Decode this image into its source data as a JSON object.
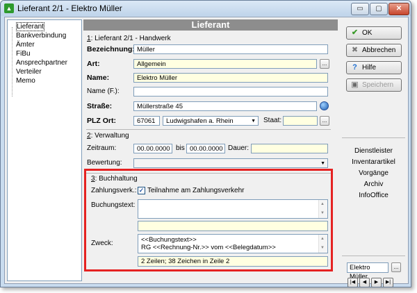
{
  "window": {
    "title": "Lieferant 2/1 - Elektro Müller",
    "minimize": "▭",
    "maximize": "▢",
    "close": "✕"
  },
  "tree": {
    "items": [
      "Lieferant",
      "Bankverbindung",
      "Ämter",
      "FiBu",
      "Ansprechpartner",
      "Verteiler",
      "Memo"
    ]
  },
  "header": {
    "title": "Lieferant"
  },
  "section1": {
    "num": "1",
    "heading": ": Lieferant 2/1 - Handwerk",
    "bezeichnung_label": "Bezeichnung:",
    "bezeichnung": "Müller",
    "art_label": "Art:",
    "art": "Allgemein",
    "name_label": "Name:",
    "name": "Elektro Müller",
    "namef_label": "Name (F.):",
    "namef": "",
    "strasse_label": "Straße:",
    "strasse": "Müllerstraße 45",
    "plz_label": "PLZ Ort:",
    "plz": "67061",
    "ort": "Ludwigshafen a. Rhein",
    "staat_label": "Staat:",
    "staat": ""
  },
  "section2": {
    "num": "2",
    "heading": ": Verwaltung",
    "zeitraum_label": "Zeitraum:",
    "von": "00.00.0000",
    "bis_label": "bis",
    "bis": "00.00.0000",
    "dauer_label": "Dauer:",
    "dauer": "",
    "bewertung_label": "Bewertung:",
    "bewertung": ""
  },
  "section3": {
    "num": "3",
    "heading": ": Buchhaltung",
    "zahlungsverk_label": "Zahlungsverk.:",
    "checkbox_label": "Teilnahme am Zahlungsverkehr",
    "checked": true,
    "buchungstext_label": "Buchungstext:",
    "buchungstext": "",
    "extra": "",
    "zweck_label": "Zweck:",
    "zweck_line1": "<<Buchungstext>>",
    "zweck_line2": "RG <<Rechnung-Nr.>> vom <<Belegdatum>>",
    "status": "2 Zeilen; 38 Zeichen in Zeile 2"
  },
  "buttons": {
    "ok": "OK",
    "abbrechen": "Abbrechen",
    "hilfe": "Hilfe",
    "speichern": "Speichern"
  },
  "links": [
    "Dienstleister",
    "Inventarartikel",
    "Vorgänge",
    "Archiv",
    "InfoOffice"
  ],
  "nav": {
    "current": "Elektro Müller",
    "more": "...",
    "first": "|◀",
    "prev": "◀",
    "next": "▶",
    "last": "▶|"
  }
}
